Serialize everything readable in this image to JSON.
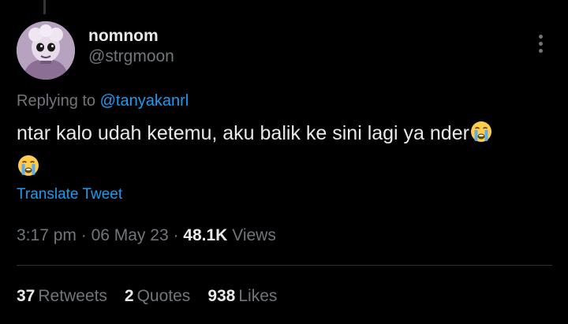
{
  "tweet": {
    "author": {
      "display_name": "nomnom",
      "handle": "@strgmoon",
      "avatar_icon": "avatar-cartoon-icon"
    },
    "replying": {
      "prefix": "Replying to",
      "mention": "@tanyakanrl"
    },
    "text": "ntar kalo udah ketemu, aku balik ke sini lagi ya nder",
    "emoji_icon": "loudly-crying-face-icon",
    "translate_label": "Translate Tweet",
    "meta": {
      "time": "3:17 pm",
      "date": "06 May 23",
      "views_count": "48.1K",
      "views_label": "Views"
    },
    "stats": {
      "retweets_count": "37",
      "retweets_label": "Retweets",
      "quotes_count": "2",
      "quotes_label": "Quotes",
      "likes_count": "938",
      "likes_label": "Likes"
    }
  },
  "colors": {
    "background": "#000000",
    "primary_text": "#e7e9ea",
    "secondary_text": "#71767b",
    "link": "#1d9bf0",
    "divider": "#2f3336"
  }
}
